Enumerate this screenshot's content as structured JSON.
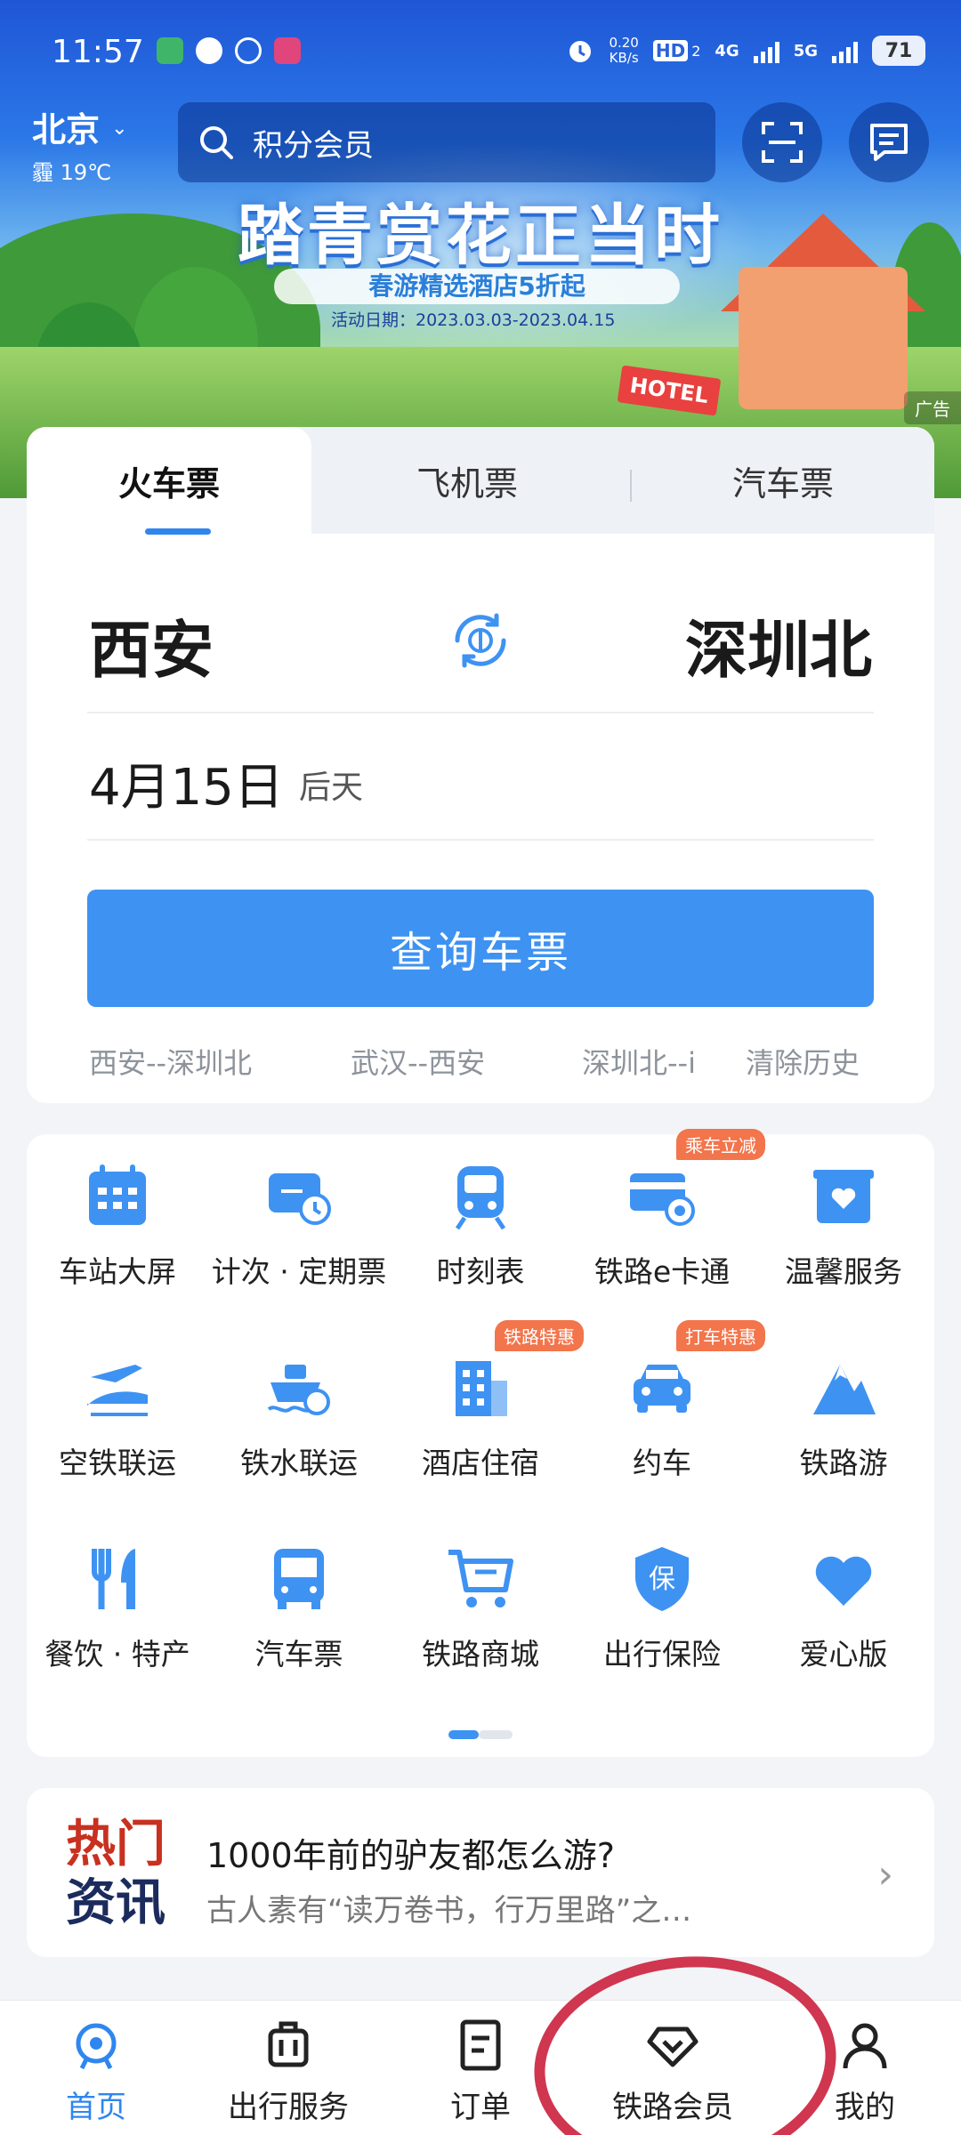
{
  "status_bar": {
    "time": "11:57",
    "net_speed_value": "0.20",
    "net_speed_unit": "KB/s",
    "hd": "HD",
    "sim": "2",
    "network_4g": "4G",
    "network_5g": "5G",
    "battery": "71"
  },
  "header": {
    "city": "北京",
    "weather": "霾 19℃",
    "search_placeholder": "积分会员"
  },
  "banner": {
    "title": "踏青赏花正当时",
    "subtitle": "春游精选酒店5折起",
    "date": "活动日期：2023.03.03-2023.04.15",
    "hotel_sign": "HOTEL",
    "ad_label": "广告"
  },
  "ticket": {
    "tabs": [
      {
        "label": "火车票",
        "active": true
      },
      {
        "label": "飞机票",
        "active": false
      },
      {
        "label": "汽车票",
        "active": false
      }
    ],
    "from": "西安",
    "to": "深圳北",
    "date": "4月15日",
    "date_relative": "后天",
    "query_button": "查询车票",
    "history": [
      "西安--深圳北",
      "武汉--西安",
      "深圳北--i"
    ],
    "clear_history": "清除历史"
  },
  "services": [
    {
      "label": "车站大屏",
      "icon": "calendar-screen-icon"
    },
    {
      "label": "计次 · 定期票",
      "icon": "ticket-clock-icon"
    },
    {
      "label": "时刻表",
      "icon": "train-icon"
    },
    {
      "label": "铁路e卡通",
      "icon": "e-card-icon",
      "badge": "乘车立减"
    },
    {
      "label": "温馨服务",
      "icon": "heart-box-icon"
    },
    {
      "label": "空铁联运",
      "icon": "plane-train-icon"
    },
    {
      "label": "铁水联运",
      "icon": "ship-train-icon"
    },
    {
      "label": "酒店住宿",
      "icon": "hotel-icon",
      "badge": "铁路特惠"
    },
    {
      "label": "约车",
      "icon": "car-icon",
      "badge": "打车特惠"
    },
    {
      "label": "铁路游",
      "icon": "mountain-icon"
    },
    {
      "label": "餐饮 · 特产",
      "icon": "food-icon"
    },
    {
      "label": "汽车票",
      "icon": "bus-icon"
    },
    {
      "label": "铁路商城",
      "icon": "cart-icon"
    },
    {
      "label": "出行保险",
      "icon": "insurance-shield-icon"
    },
    {
      "label": "爱心版",
      "icon": "heart-icon"
    }
  ],
  "news": {
    "tag_line1": "热门",
    "tag_line2": "资讯",
    "title": "1000年前的驴友都怎么游?",
    "desc": "古人素有“读万卷书，行万里路”之…"
  },
  "bottom_nav": [
    {
      "label": "首页",
      "icon": "home-train-icon",
      "active": true
    },
    {
      "label": "出行服务",
      "icon": "luggage-icon",
      "active": false
    },
    {
      "label": "订单",
      "icon": "order-icon",
      "active": false
    },
    {
      "label": "铁路会员",
      "icon": "diamond-icon",
      "active": false
    },
    {
      "label": "我的",
      "icon": "user-icon",
      "active": false
    }
  ],
  "colors": {
    "accent": "#3e92f2",
    "badge": "#f2754c",
    "annotation": "#d0364f"
  }
}
